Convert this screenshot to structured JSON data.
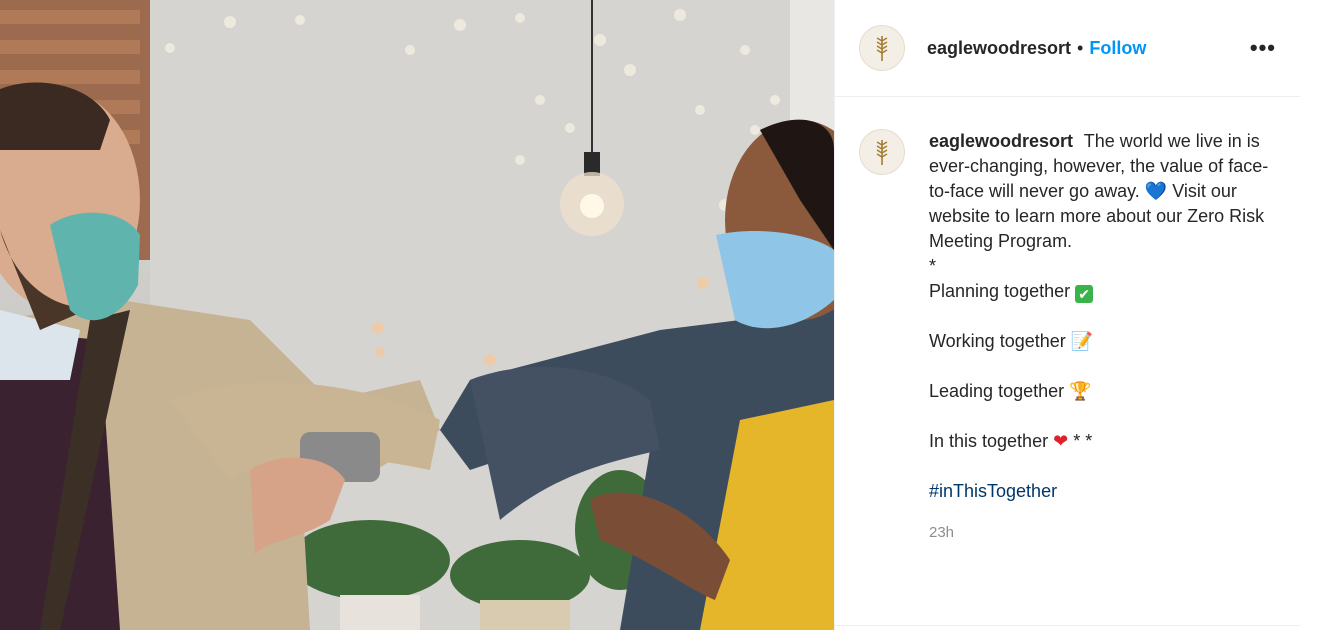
{
  "post": {
    "account": {
      "username": "eaglewoodresort",
      "separator": "•",
      "follow_label": "Follow",
      "more_label": "•••"
    },
    "caption": {
      "username": "eaglewoodresort",
      "intro": "The world we live in is ever-changing, however, the value of face-to-face will never go away.",
      "intro_emoji": "💙",
      "intro_tail": "Visit our website to learn more about our Zero Risk Meeting Program.",
      "asterisk": "*",
      "lines": [
        {
          "text": "Planning together",
          "emoji": "✔"
        },
        {
          "text": "Working together",
          "emoji": "📝"
        },
        {
          "text": "Leading together",
          "emoji": "🏆"
        },
        {
          "text": "In this together",
          "emoji": "❤",
          "tail": "* *"
        }
      ],
      "hashtag": "#inThisTogether"
    },
    "timestamp": "23h"
  },
  "colors": {
    "follow": "#0095f6",
    "hashtag": "#00376b",
    "timestamp": "#8e8e8e",
    "text": "#262626"
  },
  "icons": {
    "avatar": "wheat-logo-icon",
    "more": "more-options-icon"
  }
}
